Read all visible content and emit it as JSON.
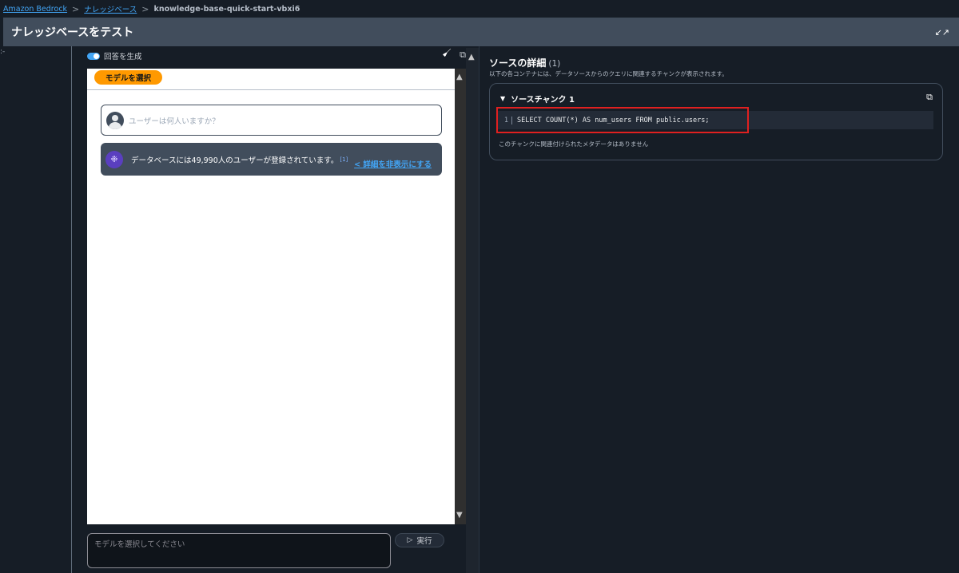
{
  "breadcrumb": {
    "items": [
      "Amazon Bedrock",
      "ナレッジベース"
    ],
    "current": "knowledge-base-quick-start-vbxi6",
    "separator": ">"
  },
  "header": {
    "title": "ナレッジベースをテスト",
    "collapse_icon": "↙↗"
  },
  "left": {
    "handle": ":-"
  },
  "toolbar": {
    "toggle_label": "回答を生成",
    "toggle_on": true,
    "broom_icon": "🧹",
    "copy_icon": "⧉"
  },
  "chat": {
    "model_button": "モデルを選択",
    "user_message": "ユーザーは何人いますか？",
    "bot_message": "データベースには49,990人のユーザーが登録されています。",
    "citation": "[1]",
    "details_link": "< 詳細を非表示にする",
    "bot_icon": "❉"
  },
  "prompt": {
    "placeholder": "モデルを選択してください",
    "run_label": "実行",
    "run_icon": "▷"
  },
  "source_panel": {
    "title": "ソースの詳細",
    "count": "(1)",
    "description": "以下の各コンテナには、データソースからのクエリに関連するチャンクが表示されます。",
    "chunk_title": "ソースチャンク 1",
    "caret": "▼",
    "copy_icon": "⧉",
    "code_line": "1",
    "code": "SELECT COUNT(*) AS num_users FROM public.users;",
    "metadata_note": "このチャンクに関連付けられたメタデータはありません"
  },
  "scroll": {
    "up": "▲",
    "down": "▼"
  },
  "colors": {
    "accent": "#42a5f5",
    "model_button": "#ff9900",
    "highlight": "#e02020",
    "header_bg": "#414d5c"
  }
}
